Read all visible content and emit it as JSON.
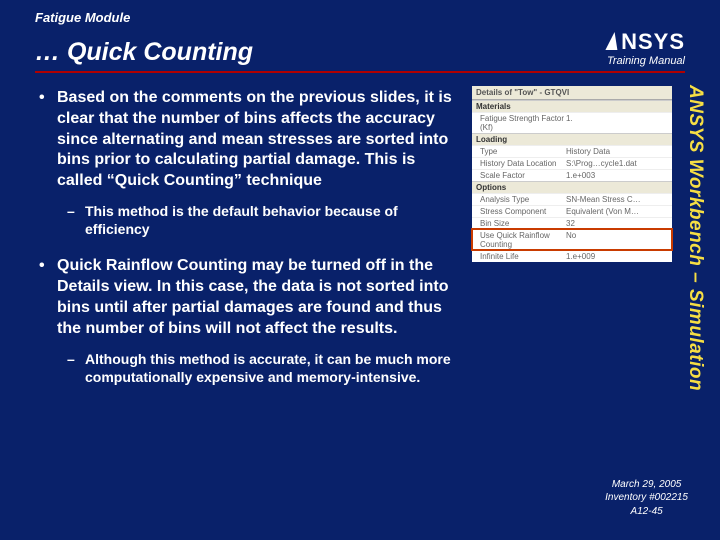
{
  "header": {
    "module": "Fatigue Module",
    "title": "… Quick Counting",
    "logo": "NSYS",
    "manual": "Training Manual"
  },
  "bullets": {
    "b1": "Based on the comments on the previous slides, it is clear that the number of bins affects the accuracy since alternating and mean stresses are sorted into bins prior to calculating partial damage.  This is called “Quick Counting” technique",
    "b1a": "This method is the default behavior because of efficiency",
    "b2": "Quick Rainflow Counting may be turned off in the Details view.  In this case, the data is not sorted into bins until after partial damages are found and thus the number of bins will not affect the results.",
    "b2a": "Although this method is accurate, it can be much more computationally expensive and memory-intensive."
  },
  "details": {
    "head": "Details of \"Tow\" - GTQVI",
    "sec1": "Materials",
    "r1k": "Fatigue Strength Factor (Kf)",
    "r1v": "1.",
    "sec2": "Loading",
    "r2k": "Type",
    "r2v": "History Data",
    "r3k": "History Data Location",
    "r3v": "S:\\Prog…cycle1.dat",
    "r4k": "Scale Factor",
    "r4v": "1.e+003",
    "sec3": "Options",
    "r5k": "Analysis Type",
    "r5v": "SN-Mean Stress C…",
    "r6k": "Stress Component",
    "r6v": "Equivalent (Von M…",
    "r7k": "Bin Size",
    "r7v": "32",
    "r8k": "Use Quick Rainflow Counting",
    "r8v": "No",
    "r9k": "Infinite Life",
    "r9v": "1.e+009"
  },
  "sidetext": "ANSYS Workbench – Simulation",
  "footer": {
    "date": "March 29, 2005",
    "inv": "Inventory #002215",
    "page": "A12-45"
  }
}
